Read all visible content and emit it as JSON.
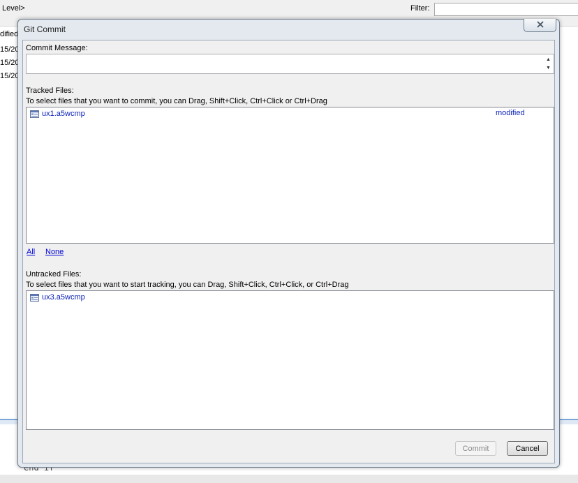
{
  "background": {
    "breadcrumb": "Level>",
    "filter_label": "Filter:",
    "filter_value": "",
    "column_header_fragment": "dified",
    "row_fragments": [
      "15/20",
      "15/20",
      "15/20"
    ],
    "code_line": "end if"
  },
  "dialog": {
    "title": "Git Commit",
    "commit_message_label": "Commit Message:",
    "commit_message_value": "",
    "tracked_label": "Tracked Files:",
    "tracked_hint": "To select files that you want to commit, you can Drag, Shift+Click, Ctrl+Click or Ctrl+Drag",
    "tracked_files": [
      {
        "name": "ux1.a5wcmp",
        "status": "modified"
      }
    ],
    "select_all_label": "All",
    "select_none_label": "None",
    "untracked_label": "Untracked Files:",
    "untracked_hint": "To select files that you want to start tracking, you can Drag, Shift+Click, Ctrl+Click, or Ctrl+Drag",
    "untracked_files": [
      {
        "name": "ux3.a5wcmp"
      }
    ],
    "commit_button": "Commit",
    "cancel_button": "Cancel"
  },
  "icons": {
    "close": "close-icon",
    "file": "file-icon",
    "scroll_up": "scroll-up-icon",
    "scroll_down": "scroll-down-icon"
  },
  "colors": {
    "link": "#0000d6",
    "file_text": "#0b20b8",
    "dialog_frame": "#e4e9ef",
    "splitter_accent": "#7aa6d6"
  }
}
